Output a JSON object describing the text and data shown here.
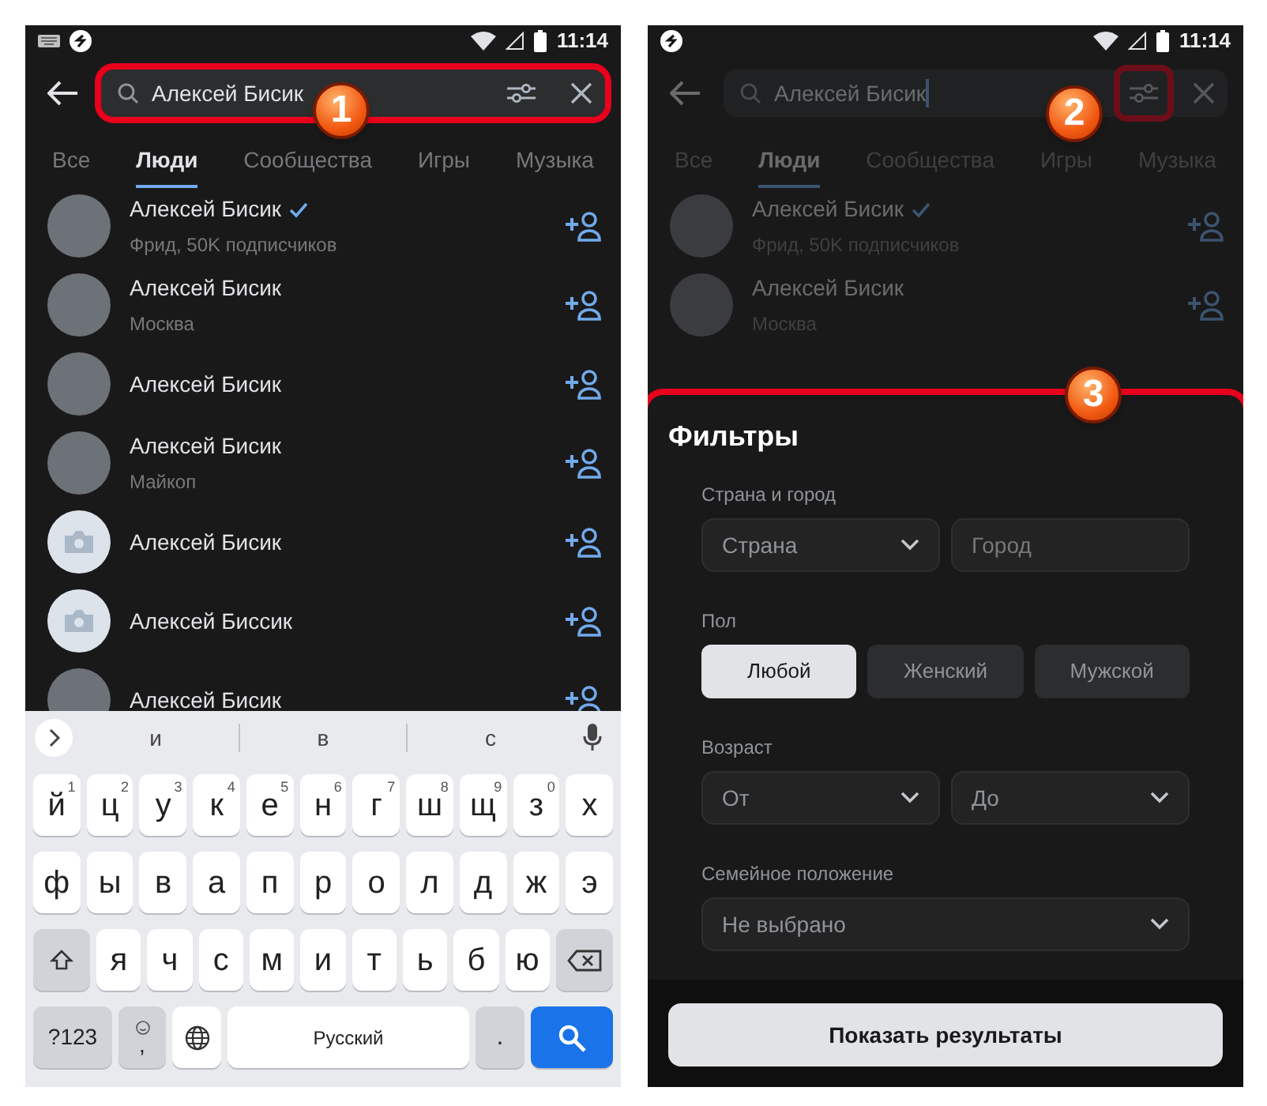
{
  "left_screen": {
    "status_bar": {
      "notification_icons": [
        {
          "kind": "keyboard"
        },
        {
          "kind": "app"
        }
      ],
      "time": "11:14"
    },
    "search": {
      "value": "Алексей Бисик",
      "focused": false
    },
    "tabs": [
      {
        "label": "Все",
        "selected": false
      },
      {
        "label": "Люди",
        "selected": true
      },
      {
        "label": "Сообщества",
        "selected": false
      },
      {
        "label": "Игры",
        "selected": false
      },
      {
        "label": "Музыка",
        "selected": false
      }
    ],
    "results": [
      {
        "kind": "photo",
        "name": "Алексей Бисик",
        "verified": true,
        "subtitle": "Фрид, 50K подписчиков"
      },
      {
        "kind": "photo",
        "name": "Алексей Бисик",
        "verified": false,
        "subtitle": "Москва"
      },
      {
        "kind": "photo",
        "name": "Алексей Бисик",
        "verified": false
      },
      {
        "kind": "photo",
        "name": "Алексей Бисик",
        "verified": false,
        "subtitle": "Майкоп"
      },
      {
        "kind": "camera",
        "name": "Алексей Бисик",
        "verified": false
      },
      {
        "kind": "camera",
        "name": "Алексей Биссик",
        "verified": false
      },
      {
        "kind": "photo",
        "name": "Алексей Бисик",
        "verified": false
      }
    ],
    "keyboard": {
      "suggestions": [
        "и",
        "в",
        "с"
      ],
      "rows": [
        [
          {
            "kind": "letter",
            "label": "й",
            "hint": "1"
          },
          {
            "kind": "letter",
            "label": "ц",
            "hint": "2"
          },
          {
            "kind": "letter",
            "label": "у",
            "hint": "3"
          },
          {
            "kind": "letter",
            "label": "к",
            "hint": "4"
          },
          {
            "kind": "letter",
            "label": "е",
            "hint": "5"
          },
          {
            "kind": "letter",
            "label": "н",
            "hint": "6"
          },
          {
            "kind": "letter",
            "label": "г",
            "hint": "7"
          },
          {
            "kind": "letter",
            "label": "ш",
            "hint": "8"
          },
          {
            "kind": "letter",
            "label": "щ",
            "hint": "9"
          },
          {
            "kind": "letter",
            "label": "з",
            "hint": "0"
          },
          {
            "kind": "letter",
            "label": "х"
          }
        ],
        [
          {
            "kind": "letter",
            "label": "ф"
          },
          {
            "kind": "letter",
            "label": "ы"
          },
          {
            "kind": "letter",
            "label": "в"
          },
          {
            "kind": "letter",
            "label": "а"
          },
          {
            "kind": "letter",
            "label": "п"
          },
          {
            "kind": "letter",
            "label": "р"
          },
          {
            "kind": "letter",
            "label": "о"
          },
          {
            "kind": "letter",
            "label": "л"
          },
          {
            "kind": "letter",
            "label": "д"
          },
          {
            "kind": "letter",
            "label": "ж"
          },
          {
            "kind": "letter",
            "label": "э"
          }
        ],
        [
          {
            "kind": "shift"
          },
          {
            "kind": "letter",
            "label": "я"
          },
          {
            "kind": "letter",
            "label": "ч"
          },
          {
            "kind": "letter",
            "label": "с"
          },
          {
            "kind": "letter",
            "label": "м"
          },
          {
            "kind": "letter",
            "label": "и"
          },
          {
            "kind": "letter",
            "label": "т"
          },
          {
            "kind": "letter",
            "label": "ь"
          },
          {
            "kind": "letter",
            "label": "б"
          },
          {
            "kind": "letter",
            "label": "ю"
          },
          {
            "kind": "backspace"
          }
        ]
      ],
      "bottom_row": [
        {
          "kind": "symbols",
          "label": "?123"
        },
        {
          "kind": "comma",
          "label": ","
        },
        {
          "kind": "globe"
        },
        {
          "kind": "space",
          "label": "Русский"
        },
        {
          "kind": "period",
          "label": "."
        },
        {
          "kind": "search"
        }
      ]
    }
  },
  "right_screen": {
    "status_bar": {
      "notification_icons": [
        {
          "kind": "app"
        }
      ],
      "time": "11:14"
    },
    "search": {
      "value": "Алексей Бисик",
      "focused": true
    },
    "tabs": [
      {
        "label": "Все",
        "selected": false
      },
      {
        "label": "Люди",
        "selected": true
      },
      {
        "label": "Сообщества",
        "selected": false
      },
      {
        "label": "Игры",
        "selected": false
      },
      {
        "label": "Музыка",
        "selected": false
      }
    ],
    "results": [
      {
        "kind": "photo",
        "name": "Алексей Бисик",
        "verified": true,
        "subtitle": "Фрид, 50K подписчиков"
      },
      {
        "kind": "photo",
        "name": "Алексей Бисик",
        "verified": false,
        "subtitle": "Москва"
      }
    ],
    "filters": {
      "title": "Фильтры",
      "sections": [
        {
          "label": "Страна и город",
          "fields": [
            {
              "kind": "dropdown",
              "value": "Страна"
            },
            {
              "kind": "input",
              "placeholder": "Город"
            }
          ]
        },
        {
          "label": "Пол",
          "options": [
            {
              "label": "Любой",
              "selected": true
            },
            {
              "label": "Женский",
              "selected": false
            },
            {
              "label": "Мужской",
              "selected": false
            }
          ]
        },
        {
          "label": "Возраст",
          "fields": [
            {
              "kind": "dropdown",
              "value": "От"
            },
            {
              "kind": "dropdown",
              "value": "До"
            }
          ]
        },
        {
          "label": "Семейное положение",
          "fields": [
            {
              "kind": "dropdown",
              "value": "Не выбрано"
            }
          ]
        }
      ]
    },
    "show_button": "Показать результаты"
  },
  "annotations": [
    {
      "number": "1",
      "kind": "search_field"
    },
    {
      "number": "2",
      "kind": "filter_button"
    },
    {
      "number": "3",
      "kind": "filters_panel"
    }
  ]
}
